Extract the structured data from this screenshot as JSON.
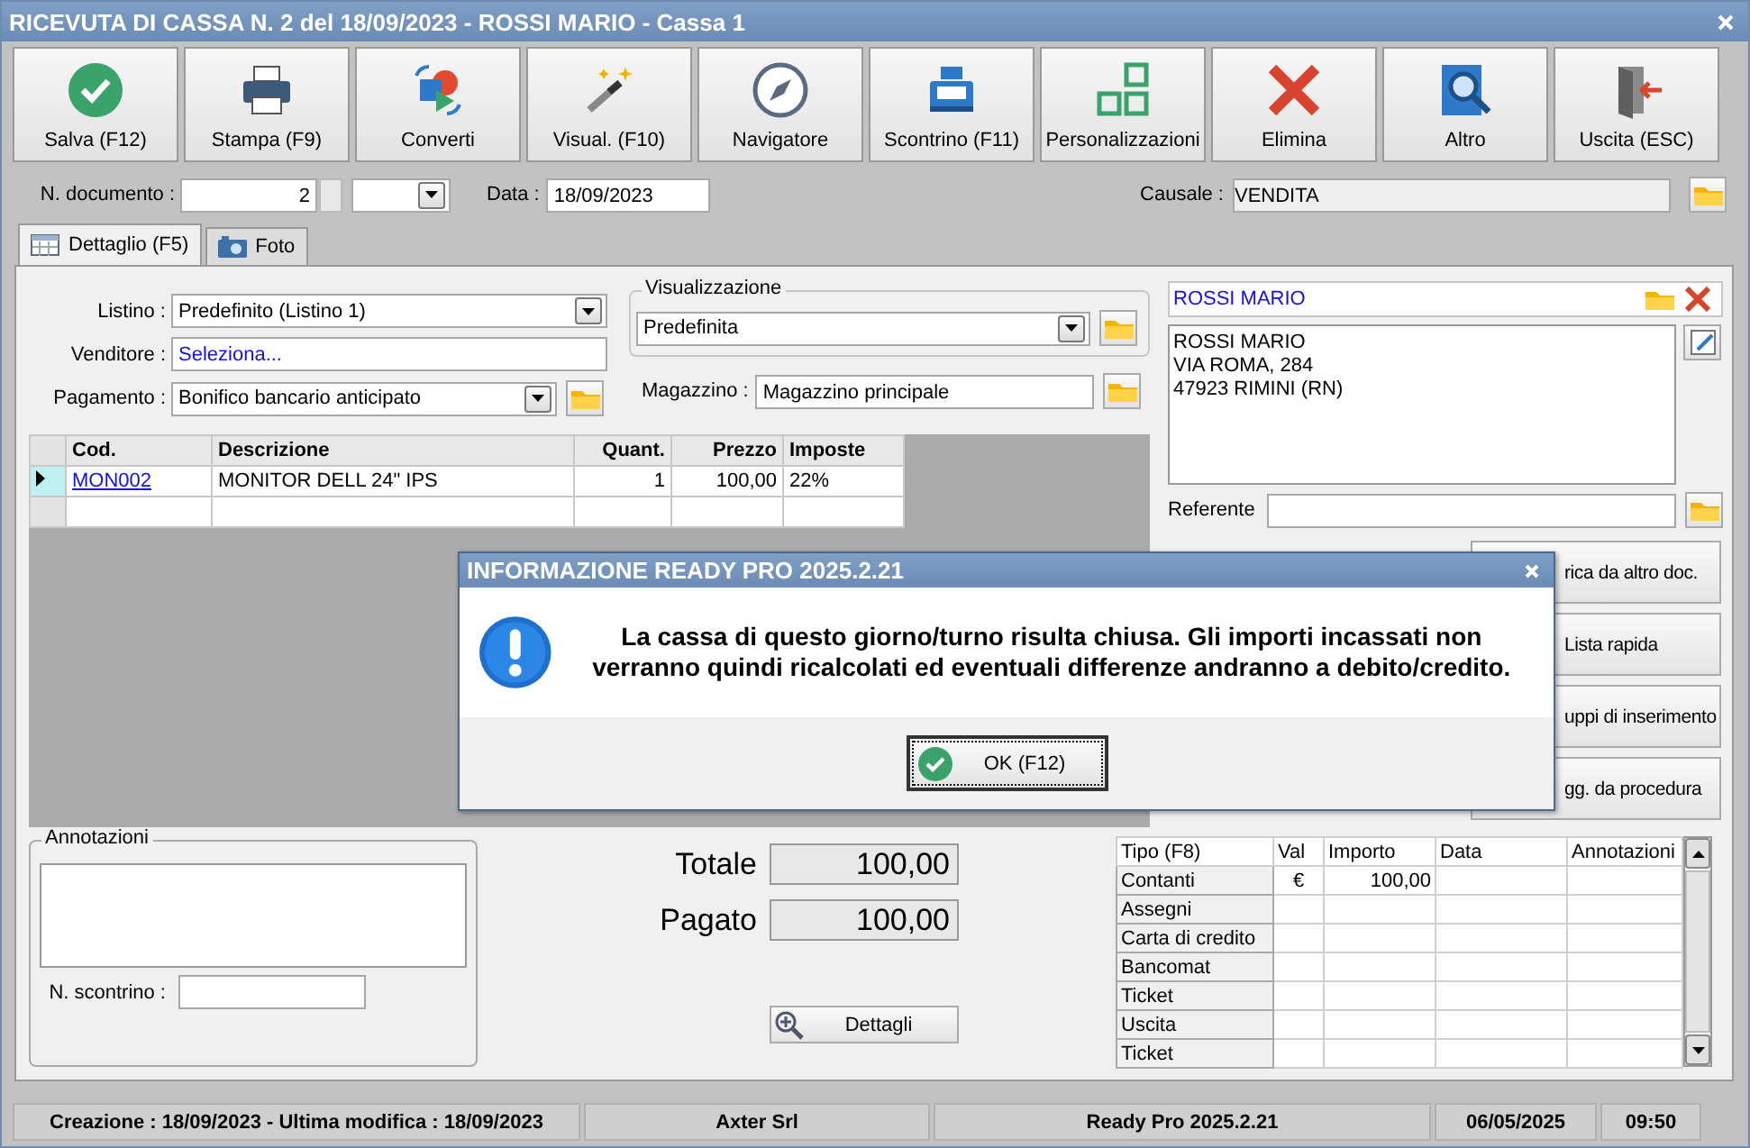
{
  "window": {
    "title": "RICEVUTA DI CASSA N. 2 del 18/09/2023 - ROSSI MARIO - Cassa 1"
  },
  "toolbar": [
    {
      "label": "Salva (F12)",
      "kind": "check"
    },
    {
      "label": "Stampa (F9)",
      "kind": "printer"
    },
    {
      "label": "Converti",
      "kind": "convert"
    },
    {
      "label": "Visual. (F10)",
      "kind": "wand"
    },
    {
      "label": "Navigatore",
      "kind": "compass"
    },
    {
      "label": "Scontrino (F11)",
      "kind": "register"
    },
    {
      "label": "Personalizzazioni",
      "kind": "squares"
    },
    {
      "label": "Elimina",
      "kind": "cross"
    },
    {
      "label": "Altro",
      "kind": "magnifier"
    },
    {
      "label": "Uscita (ESC)",
      "kind": "exit"
    }
  ],
  "document": {
    "number_label": "N. documento :",
    "number": "2",
    "date_label": "Data :",
    "date": "18/09/2023",
    "causale_label": "Causale :",
    "causale": "VENDITA"
  },
  "tabs": [
    {
      "label": "Dettaglio (F5)",
      "selected": true,
      "kind": "grid"
    },
    {
      "label": "Foto",
      "selected": false,
      "kind": "camera"
    }
  ],
  "form": {
    "listino_label": "Listino :",
    "listino": "Predefinito (Listino 1)",
    "venditore_label": "Venditore :",
    "venditore": "Seleziona...",
    "pagamento_label": "Pagamento :",
    "pagamento": "Bonifico bancario anticipato",
    "visualizzazione_title": "Visualizzazione",
    "visualizzazione": "Predefinita",
    "magazzino_label": "Magazzino :",
    "magazzino": "Magazzino principale"
  },
  "table": {
    "columns": [
      "Cod.",
      "Descrizione",
      "Quant.",
      "Prezzo",
      "Imposte"
    ],
    "rows": [
      {
        "selected": true,
        "cells": [
          "MON002",
          "MONITOR DELL 24\" IPS",
          "1",
          "100,00",
          "22%"
        ]
      }
    ]
  },
  "customer": {
    "name": "ROSSI MARIO",
    "address": [
      "ROSSI MARIO",
      "VIA ROMA, 284",
      "47923 RIMINI (RN)"
    ],
    "referente_label": "Referente"
  },
  "side_buttons": [
    "rica da altro doc.",
    "Lista rapida",
    "uppi di inserimento",
    "gg. da procedura"
  ],
  "annotations": {
    "title": "Annotazioni",
    "receipt_label": "N. scontrino :"
  },
  "totals": [
    {
      "label": "Totale",
      "value": "100,00"
    },
    {
      "label": "Pagato",
      "value": "100,00"
    }
  ],
  "details_button": "Dettagli",
  "payments": {
    "columns": [
      "Tipo (F8)",
      "Val",
      "Importo",
      "Data",
      "Annotazioni"
    ],
    "rows": [
      {
        "type": "Contanti",
        "currency": "€",
        "amount": "100,00"
      },
      {
        "type": "Assegni"
      },
      {
        "type": "Carta di credito"
      },
      {
        "type": "Bancomat"
      },
      {
        "type": "Ticket"
      },
      {
        "type": "Uscita"
      },
      {
        "type": "Ticket"
      }
    ]
  },
  "status_bar": [
    "Creazione : 18/09/2023 - Ultima modifica : 18/09/2023",
    "Axter Srl",
    "Ready Pro 2025.2.21",
    "06/05/2025",
    "09:50"
  ],
  "dialog": {
    "title": "INFORMAZIONE READY PRO 2025.2.21",
    "message": "La cassa di questo giorno/turno risulta chiusa. Gli importi incassati non verranno quindi ricalcolati ed eventuali differenze andranno a debito/credito.",
    "button": "OK (F12)"
  }
}
